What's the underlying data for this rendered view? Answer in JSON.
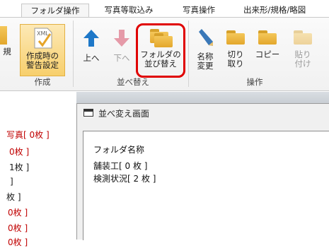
{
  "tabs": [
    {
      "label": "フォルダ操作",
      "active": true
    },
    {
      "label": "写真等取込み",
      "active": false
    },
    {
      "label": "写真操作",
      "active": false
    },
    {
      "label": "出来形/規格/略図",
      "active": false
    }
  ],
  "ribbon": {
    "partial_new_label": "規",
    "create_group": {
      "label": "作成",
      "warning_button": "作成時の\n警告設定",
      "xml_badge": "XML"
    },
    "sort_group": {
      "label": "並べ替え",
      "up_button": "上へ",
      "down_button": "下へ",
      "folder_sort_button": "フォルダの\n並び替え"
    },
    "operation_group": {
      "label": "操作",
      "rename_button": "名称\n変更",
      "cut_button": "切り\n取り",
      "copy_button": "コピー",
      "paste_button": "貼り\n付け"
    }
  },
  "left_list": [
    {
      "text": "写真[ 0枚 ]",
      "color": "#c00000"
    },
    {
      "text": "0枚 ]",
      "color": "#c00000"
    },
    {
      "text": "1枚 ]",
      "color": "#1a1a1a"
    },
    {
      "text": "]",
      "color": "#1a1a1a"
    },
    {
      "text": "枚 ]",
      "color": "#1a1a1a"
    },
    {
      "text": "0枚 ]",
      "color": "#c00000"
    },
    {
      "text": "0枚 ]",
      "color": "#c00000"
    },
    {
      "text": "0枚 ]",
      "color": "#c00000"
    }
  ],
  "dialog": {
    "title": "並べ変え画面",
    "tree_root": "フォルダ名称",
    "tree_items": [
      "舗装工[ 0 枚 ]",
      "検測状況[ 2 枚 ]"
    ]
  },
  "colors": {
    "highlight": "#e00000",
    "folder": "#e3a72c",
    "arrow_blue": "#1e78c8",
    "count_red": "#c00000"
  }
}
